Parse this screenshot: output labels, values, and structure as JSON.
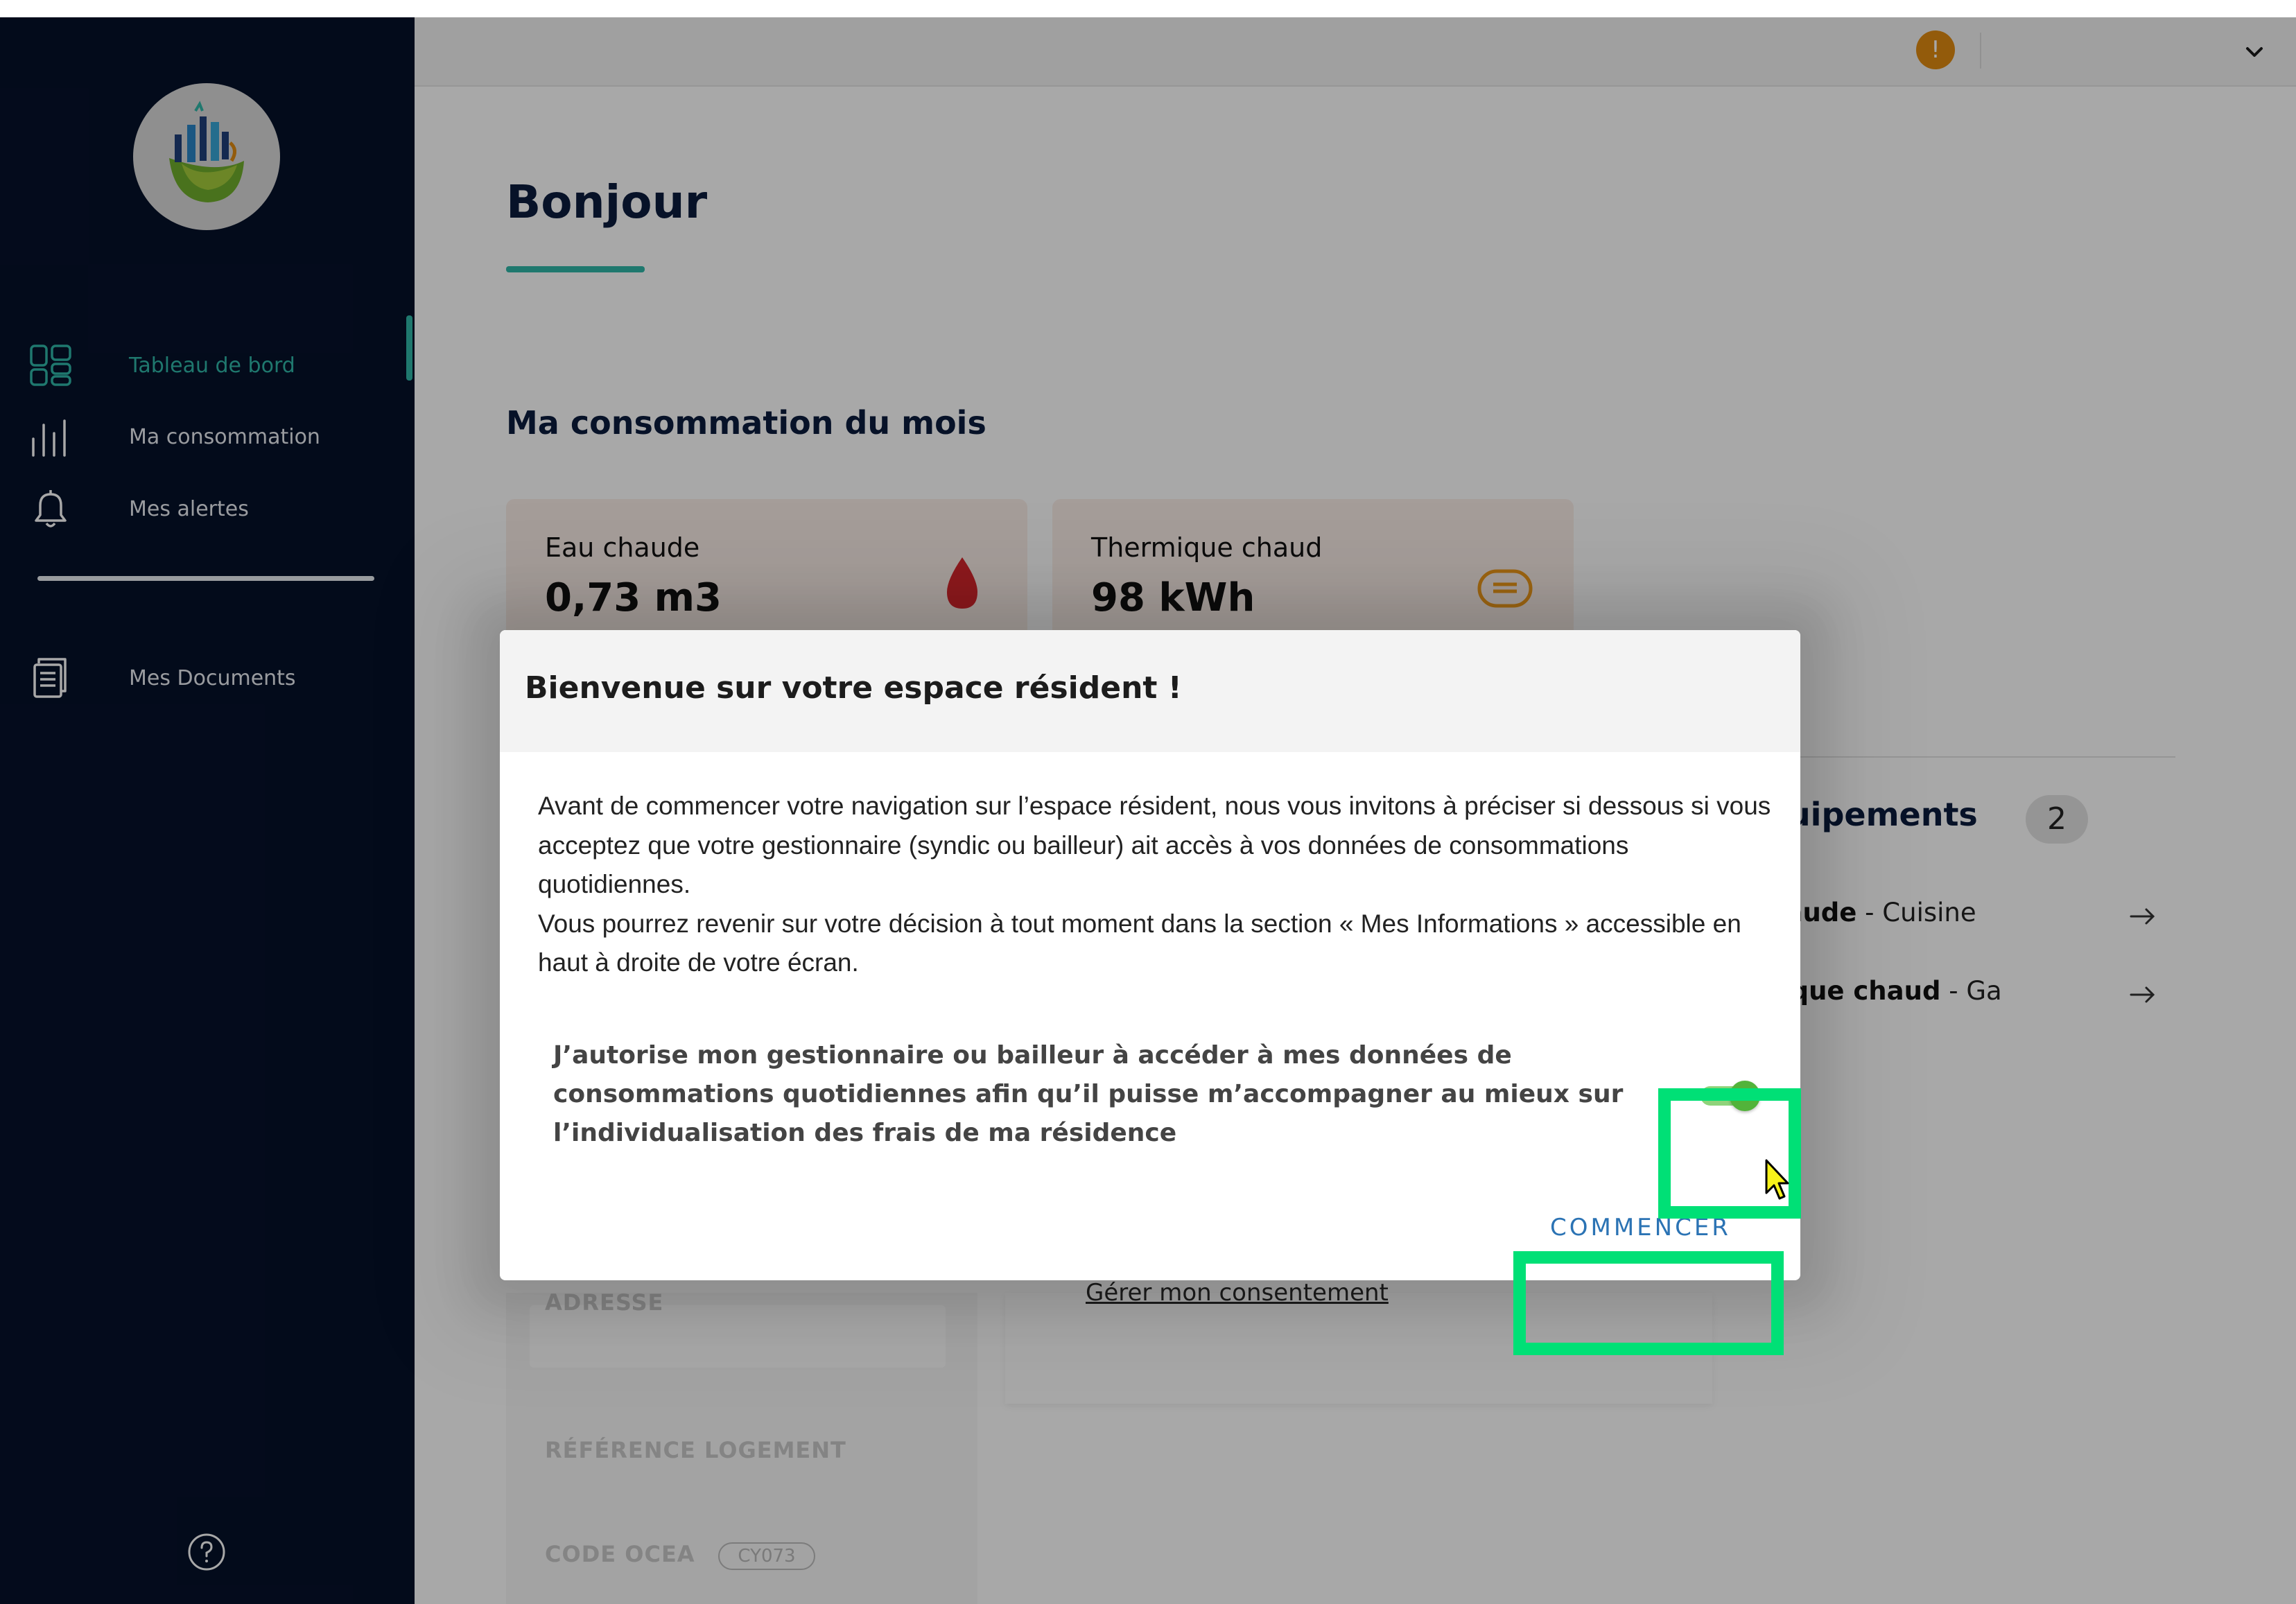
{
  "sidebar": {
    "logo": "building-leaf-logo",
    "items": [
      {
        "label": "Tableau de bord",
        "icon": "dashboard-icon",
        "active": true
      },
      {
        "label": "Ma consommation",
        "icon": "bar-chart-icon",
        "active": false
      },
      {
        "label": "Mes alertes",
        "icon": "bell-icon",
        "active": false
      },
      {
        "label": "Mes Documents",
        "icon": "document-icon",
        "active": false
      }
    ],
    "help_icon": "help-icon"
  },
  "topbar": {
    "alert_badge": "!",
    "menu_icon": "chevron-down-icon"
  },
  "page": {
    "title": "Bonjour",
    "month_section_title": "Ma consommation du mois",
    "cards": [
      {
        "label": "Eau chaude",
        "value": "0,73 m3",
        "icon": "water-drop-icon"
      },
      {
        "label": "Thermique chaud",
        "value": "98 kWh",
        "icon": "heat-icon"
      }
    ],
    "equipment": {
      "title_visible": "quipements",
      "count": "2",
      "items": [
        {
          "name_visible": "u chaude",
          "location": "Cuisine"
        },
        {
          "name_visible": "ermique chaud",
          "location": "Ga"
        }
      ]
    },
    "info": {
      "address_label": "ADRESSE",
      "reference_label": "RÉFÉRENCE LOGEMENT",
      "ocea_label": "CODE OCEA",
      "ocea_value": "CY073"
    },
    "consent_link": "Gérer mon consentement"
  },
  "modal": {
    "title": "Bienvenue sur votre espace résident !",
    "body_line_1": "Avant de commencer votre navigation sur l’espace résident, nous vous invitons à préciser si dessous si vous acceptez que votre gestionnaire (syndic ou bailleur) ait accès à vos données de consommations quotidiennes.",
    "body_line_2": "Vous pourrez revenir sur votre décision à tout moment dans la section « Mes Informations » accessible en haut à droite de votre écran.",
    "consent_text": "J’autorise mon gestionnaire ou bailleur à accéder à mes données de consommations quotidiennes afin qu’il puisse m’accompagner au mieux sur l’individualisation des frais de ma résidence",
    "toggle_on": true,
    "start_button": "COMMENCER"
  },
  "colors": {
    "sidebar_bg": "#06112a",
    "accent": "#2fb6a7",
    "highlight": "#00e076",
    "toggle_on": "#52b33a",
    "link_blue": "#2b73b4"
  }
}
